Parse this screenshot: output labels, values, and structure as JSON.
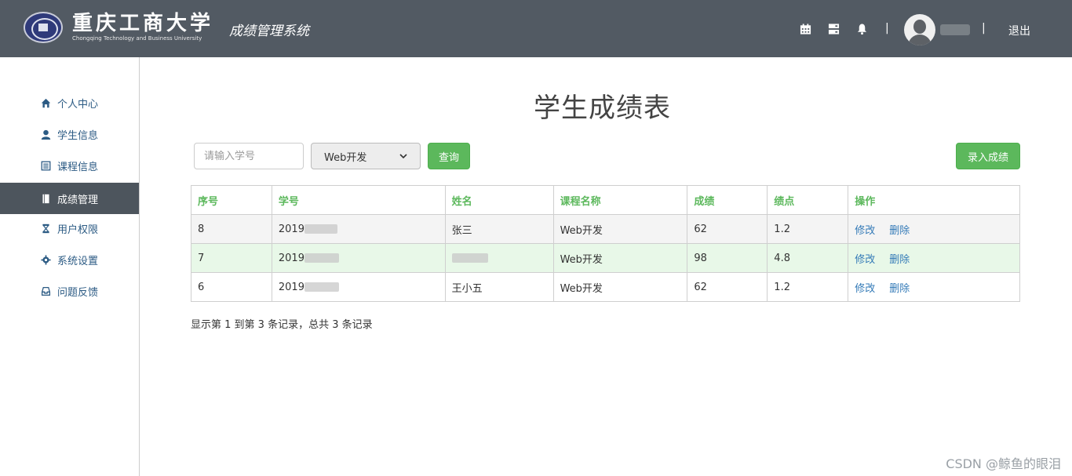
{
  "header": {
    "university_cn": "重庆工商大学",
    "university_en": "Chongqing Technology and Business University",
    "system_title": "成绩管理系统",
    "logout_label": "退出",
    "separator": "|"
  },
  "sidebar": {
    "items": [
      {
        "label": "个人中心",
        "icon": "home-icon"
      },
      {
        "label": "学生信息",
        "icon": "user-icon"
      },
      {
        "label": "课程信息",
        "icon": "list-icon"
      },
      {
        "label": "成绩管理",
        "icon": "book-icon",
        "active": true
      },
      {
        "label": "用户权限",
        "icon": "hourglass-icon"
      },
      {
        "label": "系统设置",
        "icon": "gear-icon"
      },
      {
        "label": "问题反馈",
        "icon": "inbox-icon"
      }
    ]
  },
  "main": {
    "title": "学生成绩表",
    "search_placeholder": "请输入学号",
    "course_selected": "Web开发",
    "query_label": "查询",
    "add_label": "录入成绩",
    "table": {
      "headers": [
        "序号",
        "学号",
        "姓名",
        "课程名称",
        "成绩",
        "绩点",
        "操作"
      ],
      "rows": [
        {
          "index": "8",
          "student_id": "2019",
          "name": "张三",
          "course": "Web开发",
          "score": "62",
          "gpa": "1.2"
        },
        {
          "index": "7",
          "student_id": "2019",
          "name": "",
          "course": "Web开发",
          "score": "98",
          "gpa": "4.8"
        },
        {
          "index": "6",
          "student_id": "2019",
          "name": "王小五",
          "course": "Web开发",
          "score": "62",
          "gpa": "1.2"
        }
      ],
      "edit_label": "修改",
      "delete_label": "删除"
    },
    "summary": "显示第 1 到第 3 条记录，总共 3 条记录"
  },
  "watermark": "CSDN @鲸鱼的眼泪",
  "colors": {
    "header_bg": "#525a63",
    "accent_green": "#5cb85c",
    "link_blue": "#337ab7",
    "sidebar_active": "#4d555d"
  }
}
